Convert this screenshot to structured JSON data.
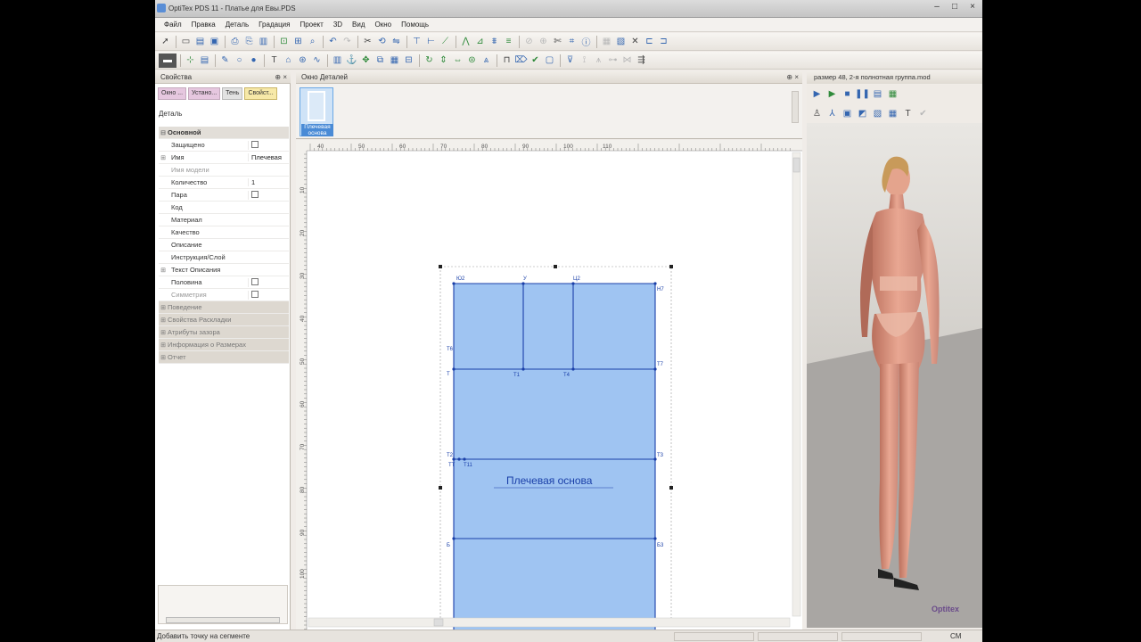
{
  "window": {
    "title": "OptiTex PDS 11 - Платье для Евы.PDS",
    "controls": [
      "–",
      "□",
      "×"
    ]
  },
  "menu": [
    "Файл",
    "Правка",
    "Деталь",
    "Градация",
    "Проект",
    "3D",
    "Вид",
    "Окно",
    "Помощь"
  ],
  "properties": {
    "title": "Свойства",
    "tabs": [
      "Окно ...",
      "Устано...",
      "Тень",
      "Свойст..."
    ],
    "subtitle": "Деталь",
    "group_main": "Основной",
    "rows": [
      {
        "key": "Защищено",
        "value": "",
        "checkbox": true
      },
      {
        "key": "Имя",
        "value": "Плечевая"
      },
      {
        "key": "Имя модели",
        "value": "",
        "dim": true
      },
      {
        "key": "Количество",
        "value": "1"
      },
      {
        "key": "Пара",
        "value": "",
        "checkbox": true
      },
      {
        "key": "Код",
        "value": ""
      },
      {
        "key": "Материал",
        "value": ""
      },
      {
        "key": "Качество",
        "value": ""
      },
      {
        "key": "Описание",
        "value": ""
      },
      {
        "key": "Инструкция/Слой",
        "value": ""
      },
      {
        "key": "Текст Описания",
        "value": ""
      },
      {
        "key": "Половина",
        "value": "",
        "checkbox": true
      },
      {
        "key": "Симметрия",
        "value": "",
        "checkbox": true,
        "dim": true
      }
    ],
    "groups": [
      "Поведение",
      "Свойства Раскладки",
      "Атрибуты зазора",
      "Информация о Размерах",
      "Отчет"
    ]
  },
  "detail_window": {
    "title": "Окно Деталей",
    "thumbnail_label": "Плечевая основа"
  },
  "canvas": {
    "piece_name": "Плечевая основа",
    "ruler_top": [
      "40",
      "50",
      "60",
      "70",
      "80",
      "90",
      "100",
      "110"
    ],
    "ruler_left": [
      "10",
      "20",
      "30",
      "40",
      "50",
      "60",
      "70",
      "80",
      "90",
      "100"
    ],
    "point_labels": [
      "Ю2",
      "У",
      "Ц2",
      "Н7",
      "Т7",
      "Т",
      "Т1",
      "Т4",
      "Т6",
      "Т2",
      "Т3",
      "ТТ",
      "Т11",
      "Б",
      "Б3"
    ],
    "fill_color": "#9fc4f2",
    "line_color": "#1a3fa8"
  },
  "view3d": {
    "title": "размер 48, 2-я полнотная группа.mod",
    "logo": "Optitex"
  },
  "status": {
    "text": "Добавить точку на сегменте",
    "units": "СМ"
  }
}
